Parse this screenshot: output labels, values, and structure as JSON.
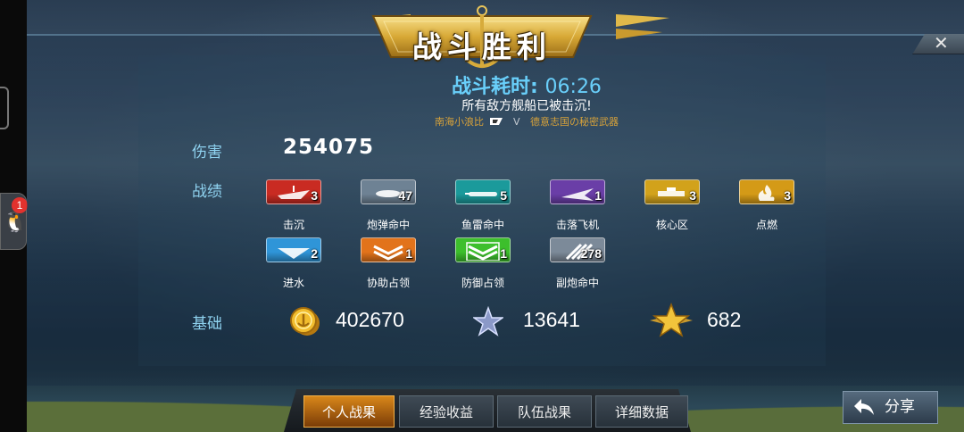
{
  "title": "战斗胜利",
  "duration": {
    "label": "战斗耗时:",
    "time": "06:26"
  },
  "result_message": "所有敌方舰船已被击沉!",
  "matchup": {
    "left": "南海小浪比",
    "vs": "V",
    "right": "德意志国の秘密武器"
  },
  "close_label": "✕",
  "stats": {
    "damage_label": "伤害",
    "damage_value": "254075",
    "achievements_label": "战绩",
    "base_label": "基础"
  },
  "achievements": [
    {
      "label": "击沉",
      "count": "3",
      "color": "#c92b22",
      "icon": "ship-sinking-icon"
    },
    {
      "label": "炮弹命中",
      "count": "47",
      "color": "#6e8294",
      "icon": "shell-hit-icon"
    },
    {
      "label": "鱼雷命中",
      "count": "5",
      "color": "#1b9a9b",
      "icon": "torpedo-hit-icon"
    },
    {
      "label": "击落飞机",
      "count": "1",
      "color": "#6a3ea7",
      "icon": "plane-shootdown-icon"
    },
    {
      "label": "核心区",
      "count": "3",
      "color": "#d2a21b",
      "icon": "core-zone-icon"
    },
    {
      "label": "点燃",
      "count": "3",
      "color": "#d49a17",
      "icon": "fire-icon"
    },
    {
      "label": "进水",
      "count": "2",
      "color": "#2f95d8",
      "icon": "flooding-icon"
    },
    {
      "label": "协助占领",
      "count": "1",
      "color": "#e2731b",
      "icon": "assist-capture-icon"
    },
    {
      "label": "防御占领",
      "count": "1",
      "color": "#3dbf2c",
      "icon": "defend-capture-icon"
    },
    {
      "label": "副炮命中",
      "count": "278",
      "color": "#7c8a99",
      "icon": "secondary-gun-icon"
    }
  ],
  "base_rewards": [
    {
      "icon": "gold-coin-icon",
      "value": "402670"
    },
    {
      "icon": "silver-star-icon",
      "value": "13641"
    },
    {
      "icon": "gold-star-icon",
      "value": "682"
    }
  ],
  "tabs": [
    {
      "label": "个人战果",
      "active": true
    },
    {
      "label": "经验收益",
      "active": false
    },
    {
      "label": "队伍战果",
      "active": false
    },
    {
      "label": "详细数据",
      "active": false
    }
  ],
  "share_label": "分享",
  "notification_count": "1"
}
